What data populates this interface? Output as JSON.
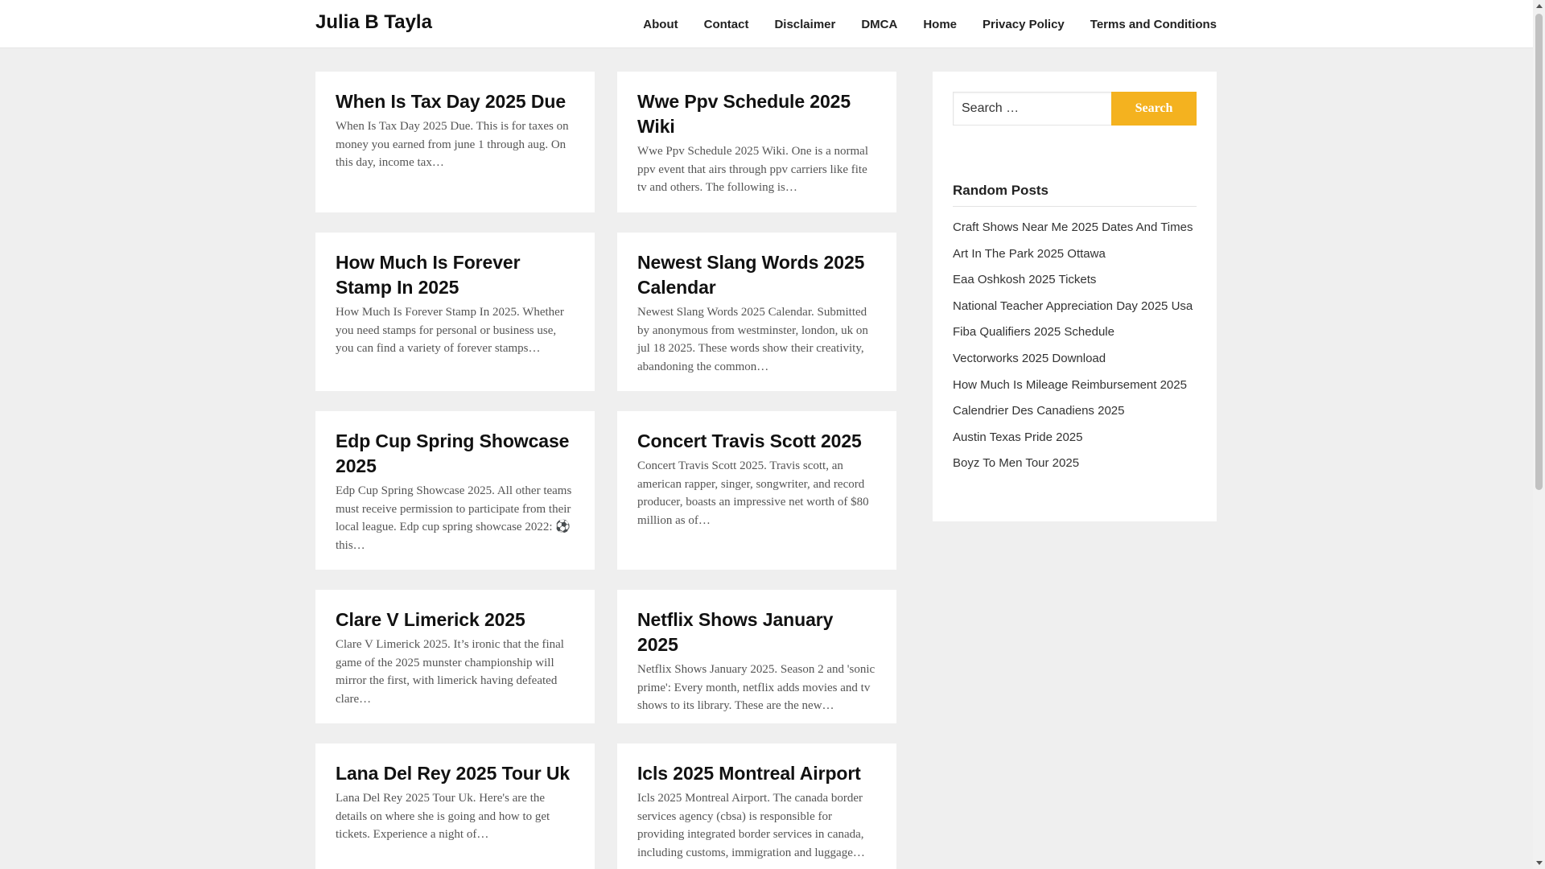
{
  "header": {
    "site_title": "Julia B Tayla",
    "nav": [
      "About",
      "Contact",
      "Disclaimer",
      "DMCA",
      "Home",
      "Privacy Policy",
      "Terms and Conditions"
    ]
  },
  "posts": [
    {
      "title": "When Is Tax Day 2025 Due",
      "excerpt": "When Is Tax Day 2025 Due. This is for taxes on money you earned from june 1 through aug. On this day, income tax…"
    },
    {
      "title": "Wwe Ppv Schedule 2025 Wiki",
      "excerpt": "Wwe Ppv Schedule 2025 Wiki. One is a normal ppv event that airs through ppv carriers like fite tv and others. The following is…"
    },
    {
      "title": "How Much Is Forever Stamp In 2025",
      "excerpt": "How Much Is Forever Stamp In 2025. Whether you need stamps for personal or business use, you can find a variety of forever stamps…"
    },
    {
      "title": "Newest Slang Words 2025 Calendar",
      "excerpt": "Newest Slang Words 2025 Calendar. Submitted by anonymous from westminster, london, uk on jul 18 2025. These words show their creativity, abandoning the common…"
    },
    {
      "title": "Edp Cup Spring Showcase 2025",
      "excerpt": "Edp Cup Spring Showcase 2025. All other teams must receive permission to participate from their local league. Edp cup spring showcase 2022: ⚽ this…"
    },
    {
      "title": "Concert Travis Scott 2025",
      "excerpt": "Concert Travis Scott 2025. Travis scott, an american rapper, singer, songwriter, and record producer, boasts an impressive net worth of $80 million as of…"
    },
    {
      "title": "Clare V Limerick 2025",
      "excerpt": "Clare V Limerick 2025. It’s ironic that the final game of the 2025 munster championship will mirror the first, with limerick having defeated clare…"
    },
    {
      "title": "Netflix Shows January 2025",
      "excerpt": "Netflix Shows January 2025. Season 2 and 'sonic prime': Every month, netflix adds movies and tv shows to its library. These are the new…"
    },
    {
      "title": "Lana Del Rey 2025 Tour Uk",
      "excerpt": "Lana Del Rey 2025 Tour Uk. Here's are the details on where she is going and how to get tickets. Experience a night of…"
    },
    {
      "title": "Icls 2025 Montreal Airport",
      "excerpt": "Icls 2025 Montreal Airport. The canada border services agency (cbsa) is responsible for providing integrated border services in canada, including customs, immigration and luggage…"
    }
  ],
  "sidebar": {
    "search_placeholder": "Search …",
    "search_button": "Search",
    "random_title": "Random Posts",
    "random_posts": [
      "Craft Shows Near Me 2025 Dates And Times",
      "Art In The Park 2025 Ottawa",
      "Eaa Oshkosh 2025 Tickets",
      "National Teacher Appreciation Day 2025 Usa",
      "Fiba Qualifiers 2025 Schedule",
      "Vectorworks 2025 Download",
      "How Much Is Mileage Reimbursement 2025",
      "Calendrier Des Canadiens 2025",
      "Austin Texas Pride 2025",
      "Boyz To Men Tour 2025"
    ]
  },
  "colors": {
    "accent": "#f4b21f",
    "background": "#efefef"
  }
}
